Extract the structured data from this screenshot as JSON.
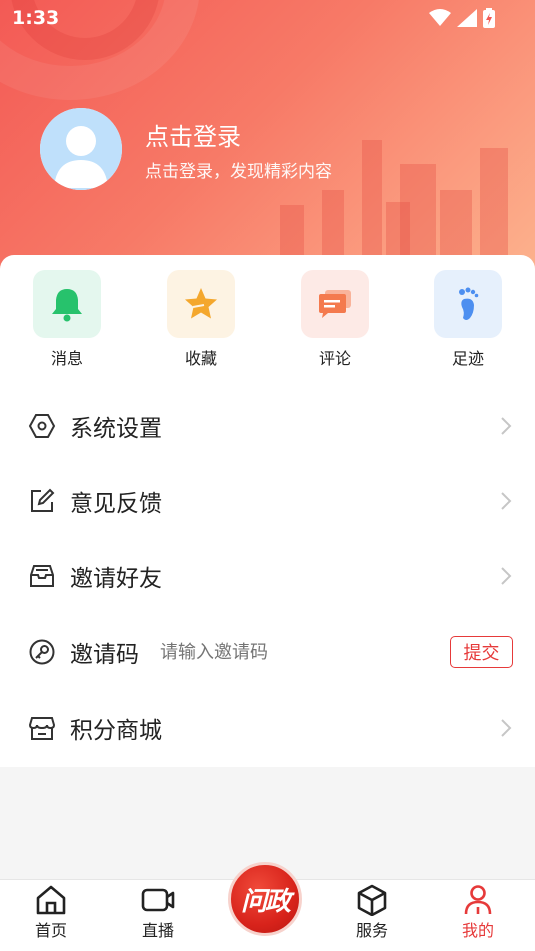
{
  "status_bar": {
    "time": "1:33"
  },
  "profile": {
    "login_title": "点击登录",
    "login_subtitle": "点击登录，发现精彩内容"
  },
  "quick_actions": [
    {
      "label": "消息",
      "icon": "bell-icon",
      "bg": "#e4f7ee",
      "color": "#27c26c"
    },
    {
      "label": "收藏",
      "icon": "star-icon",
      "bg": "#fdf3e3",
      "color": "#f4a72d"
    },
    {
      "label": "评论",
      "icon": "comment-icon",
      "bg": "#fdeae6",
      "color": "#f47a4e"
    },
    {
      "label": "足迹",
      "icon": "footprint-icon",
      "bg": "#e6f0fc",
      "color": "#4d8ff0"
    }
  ],
  "menu": {
    "settings": "系统设置",
    "feedback": "意见反馈",
    "invite_friends": "邀请好友",
    "invite_code": "邀请码",
    "invite_code_placeholder": "请输入邀请码",
    "submit": "提交",
    "points_mall": "积分商城"
  },
  "tabbar": {
    "home": "首页",
    "live": "直播",
    "center": "问政",
    "services": "服务",
    "mine": "我的"
  },
  "colors": {
    "accent": "#e63a3a",
    "header_start": "#f35a55",
    "header_end": "#fcb48e"
  }
}
